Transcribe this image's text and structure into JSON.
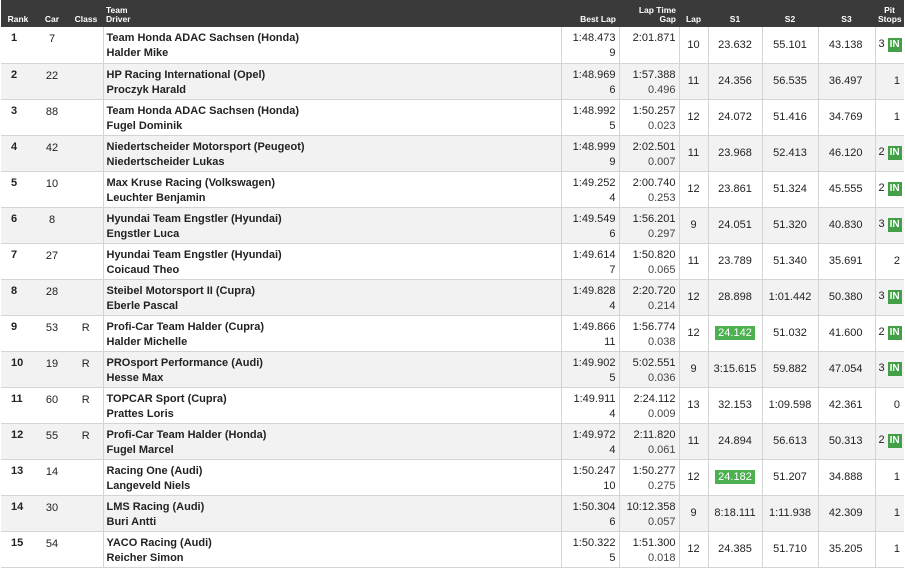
{
  "headers": {
    "rank": "Rank",
    "car": "Car",
    "class": "Class",
    "team": "Team",
    "driver": "Driver",
    "best_lap": "Best Lap",
    "lap_time": "Lap Time",
    "gap": "Gap",
    "lap": "Lap",
    "s1": "S1",
    "s2": "S2",
    "s3": "S3",
    "pit": "Pit",
    "stops": "Stops"
  },
  "rows": [
    {
      "rank": "1",
      "car": "7",
      "class": "",
      "team": "Team Honda ADAC Sachsen (Honda)",
      "driver": "Halder Mike",
      "best": "1:48.473",
      "best_lap": "9",
      "laptime": "2:01.871",
      "gap": "",
      "lap": "10",
      "s1": "23.632",
      "s1_hl": false,
      "s2": "55.101",
      "s3": "43.138",
      "pit": "3",
      "in": "IN"
    },
    {
      "rank": "2",
      "car": "22",
      "class": "",
      "team": "HP Racing International (Opel)",
      "driver": "Proczyk Harald",
      "best": "1:48.969",
      "best_lap": "6",
      "laptime": "1:57.388",
      "gap": "0.496",
      "lap": "11",
      "s1": "24.356",
      "s1_hl": false,
      "s2": "56.535",
      "s3": "36.497",
      "pit": "1",
      "in": ""
    },
    {
      "rank": "3",
      "car": "88",
      "class": "",
      "team": "Team Honda ADAC Sachsen (Honda)",
      "driver": "Fugel Dominik",
      "best": "1:48.992",
      "best_lap": "5",
      "laptime": "1:50.257",
      "gap": "0.023",
      "lap": "12",
      "s1": "24.072",
      "s1_hl": false,
      "s2": "51.416",
      "s3": "34.769",
      "pit": "1",
      "in": ""
    },
    {
      "rank": "4",
      "car": "42",
      "class": "",
      "team": "Niedertscheider Motorsport (Peugeot)",
      "driver": "Niedertscheider Lukas",
      "best": "1:48.999",
      "best_lap": "9",
      "laptime": "2:02.501",
      "gap": "0.007",
      "lap": "11",
      "s1": "23.968",
      "s1_hl": false,
      "s2": "52.413",
      "s3": "46.120",
      "pit": "2",
      "in": "IN"
    },
    {
      "rank": "5",
      "car": "10",
      "class": "",
      "team": "Max Kruse Racing (Volkswagen)",
      "driver": "Leuchter Benjamin",
      "best": "1:49.252",
      "best_lap": "4",
      "laptime": "2:00.740",
      "gap": "0.253",
      "lap": "12",
      "s1": "23.861",
      "s1_hl": false,
      "s2": "51.324",
      "s3": "45.555",
      "pit": "2",
      "in": "IN"
    },
    {
      "rank": "6",
      "car": "8",
      "class": "",
      "team": "Hyundai Team Engstler (Hyundai)",
      "driver": "Engstler Luca",
      "best": "1:49.549",
      "best_lap": "6",
      "laptime": "1:56.201",
      "gap": "0.297",
      "lap": "9",
      "s1": "24.051",
      "s1_hl": false,
      "s2": "51.320",
      "s3": "40.830",
      "pit": "3",
      "in": "IN"
    },
    {
      "rank": "7",
      "car": "27",
      "class": "",
      "team": "Hyundai Team Engstler (Hyundai)",
      "driver": "Coicaud Theo",
      "best": "1:49.614",
      "best_lap": "7",
      "laptime": "1:50.820",
      "gap": "0.065",
      "lap": "11",
      "s1": "23.789",
      "s1_hl": false,
      "s2": "51.340",
      "s3": "35.691",
      "pit": "2",
      "in": ""
    },
    {
      "rank": "8",
      "car": "28",
      "class": "",
      "team": "Steibel Motorsport II (Cupra)",
      "driver": "Eberle Pascal",
      "best": "1:49.828",
      "best_lap": "4",
      "laptime": "2:20.720",
      "gap": "0.214",
      "lap": "12",
      "s1": "28.898",
      "s1_hl": false,
      "s2": "1:01.442",
      "s3": "50.380",
      "pit": "3",
      "in": "IN"
    },
    {
      "rank": "9",
      "car": "53",
      "class": "R",
      "team": "Profi-Car Team Halder (Cupra)",
      "driver": "Halder Michelle",
      "best": "1:49.866",
      "best_lap": "11",
      "laptime": "1:56.774",
      "gap": "0.038",
      "lap": "12",
      "s1": "24.142",
      "s1_hl": true,
      "s2": "51.032",
      "s3": "41.600",
      "pit": "2",
      "in": "IN"
    },
    {
      "rank": "10",
      "car": "19",
      "class": "R",
      "team": "PROsport Performance (Audi)",
      "driver": "Hesse Max",
      "best": "1:49.902",
      "best_lap": "5",
      "laptime": "5:02.551",
      "gap": "0.036",
      "lap": "9",
      "s1": "3:15.615",
      "s1_hl": false,
      "s2": "59.882",
      "s3": "47.054",
      "pit": "3",
      "in": "IN"
    },
    {
      "rank": "11",
      "car": "60",
      "class": "R",
      "team": "TOPCAR Sport (Cupra)",
      "driver": "Prattes Loris",
      "best": "1:49.911",
      "best_lap": "4",
      "laptime": "2:24.112",
      "gap": "0.009",
      "lap": "13",
      "s1": "32.153",
      "s1_hl": false,
      "s2": "1:09.598",
      "s3": "42.361",
      "pit": "0",
      "in": ""
    },
    {
      "rank": "12",
      "car": "55",
      "class": "R",
      "team": "Profi-Car Team Halder (Honda)",
      "driver": "Fugel Marcel",
      "best": "1:49.972",
      "best_lap": "4",
      "laptime": "2:11.820",
      "gap": "0.061",
      "lap": "11",
      "s1": "24.894",
      "s1_hl": false,
      "s2": "56.613",
      "s3": "50.313",
      "pit": "2",
      "in": "IN"
    },
    {
      "rank": "13",
      "car": "14",
      "class": "",
      "team": "Racing One (Audi)",
      "driver": "Langeveld Niels",
      "best": "1:50.247",
      "best_lap": "10",
      "laptime": "1:50.277",
      "gap": "0.275",
      "lap": "12",
      "s1": "24.182",
      "s1_hl": true,
      "s2": "51.207",
      "s3": "34.888",
      "pit": "1",
      "in": ""
    },
    {
      "rank": "14",
      "car": "30",
      "class": "",
      "team": "LMS Racing (Audi)",
      "driver": "Buri Antti",
      "best": "1:50.304",
      "best_lap": "6",
      "laptime": "10:12.358",
      "gap": "0.057",
      "lap": "9",
      "s1": "8:18.111",
      "s1_hl": false,
      "s2": "1:11.938",
      "s3": "42.309",
      "pit": "1",
      "in": ""
    },
    {
      "rank": "15",
      "car": "54",
      "class": "",
      "team": "YACO Racing (Audi)",
      "driver": "Reicher Simon",
      "best": "1:50.322",
      "best_lap": "5",
      "laptime": "1:51.300",
      "gap": "0.018",
      "lap": "12",
      "s1": "24.385",
      "s1_hl": false,
      "s2": "51.710",
      "s3": "35.205",
      "pit": "1",
      "in": ""
    }
  ]
}
